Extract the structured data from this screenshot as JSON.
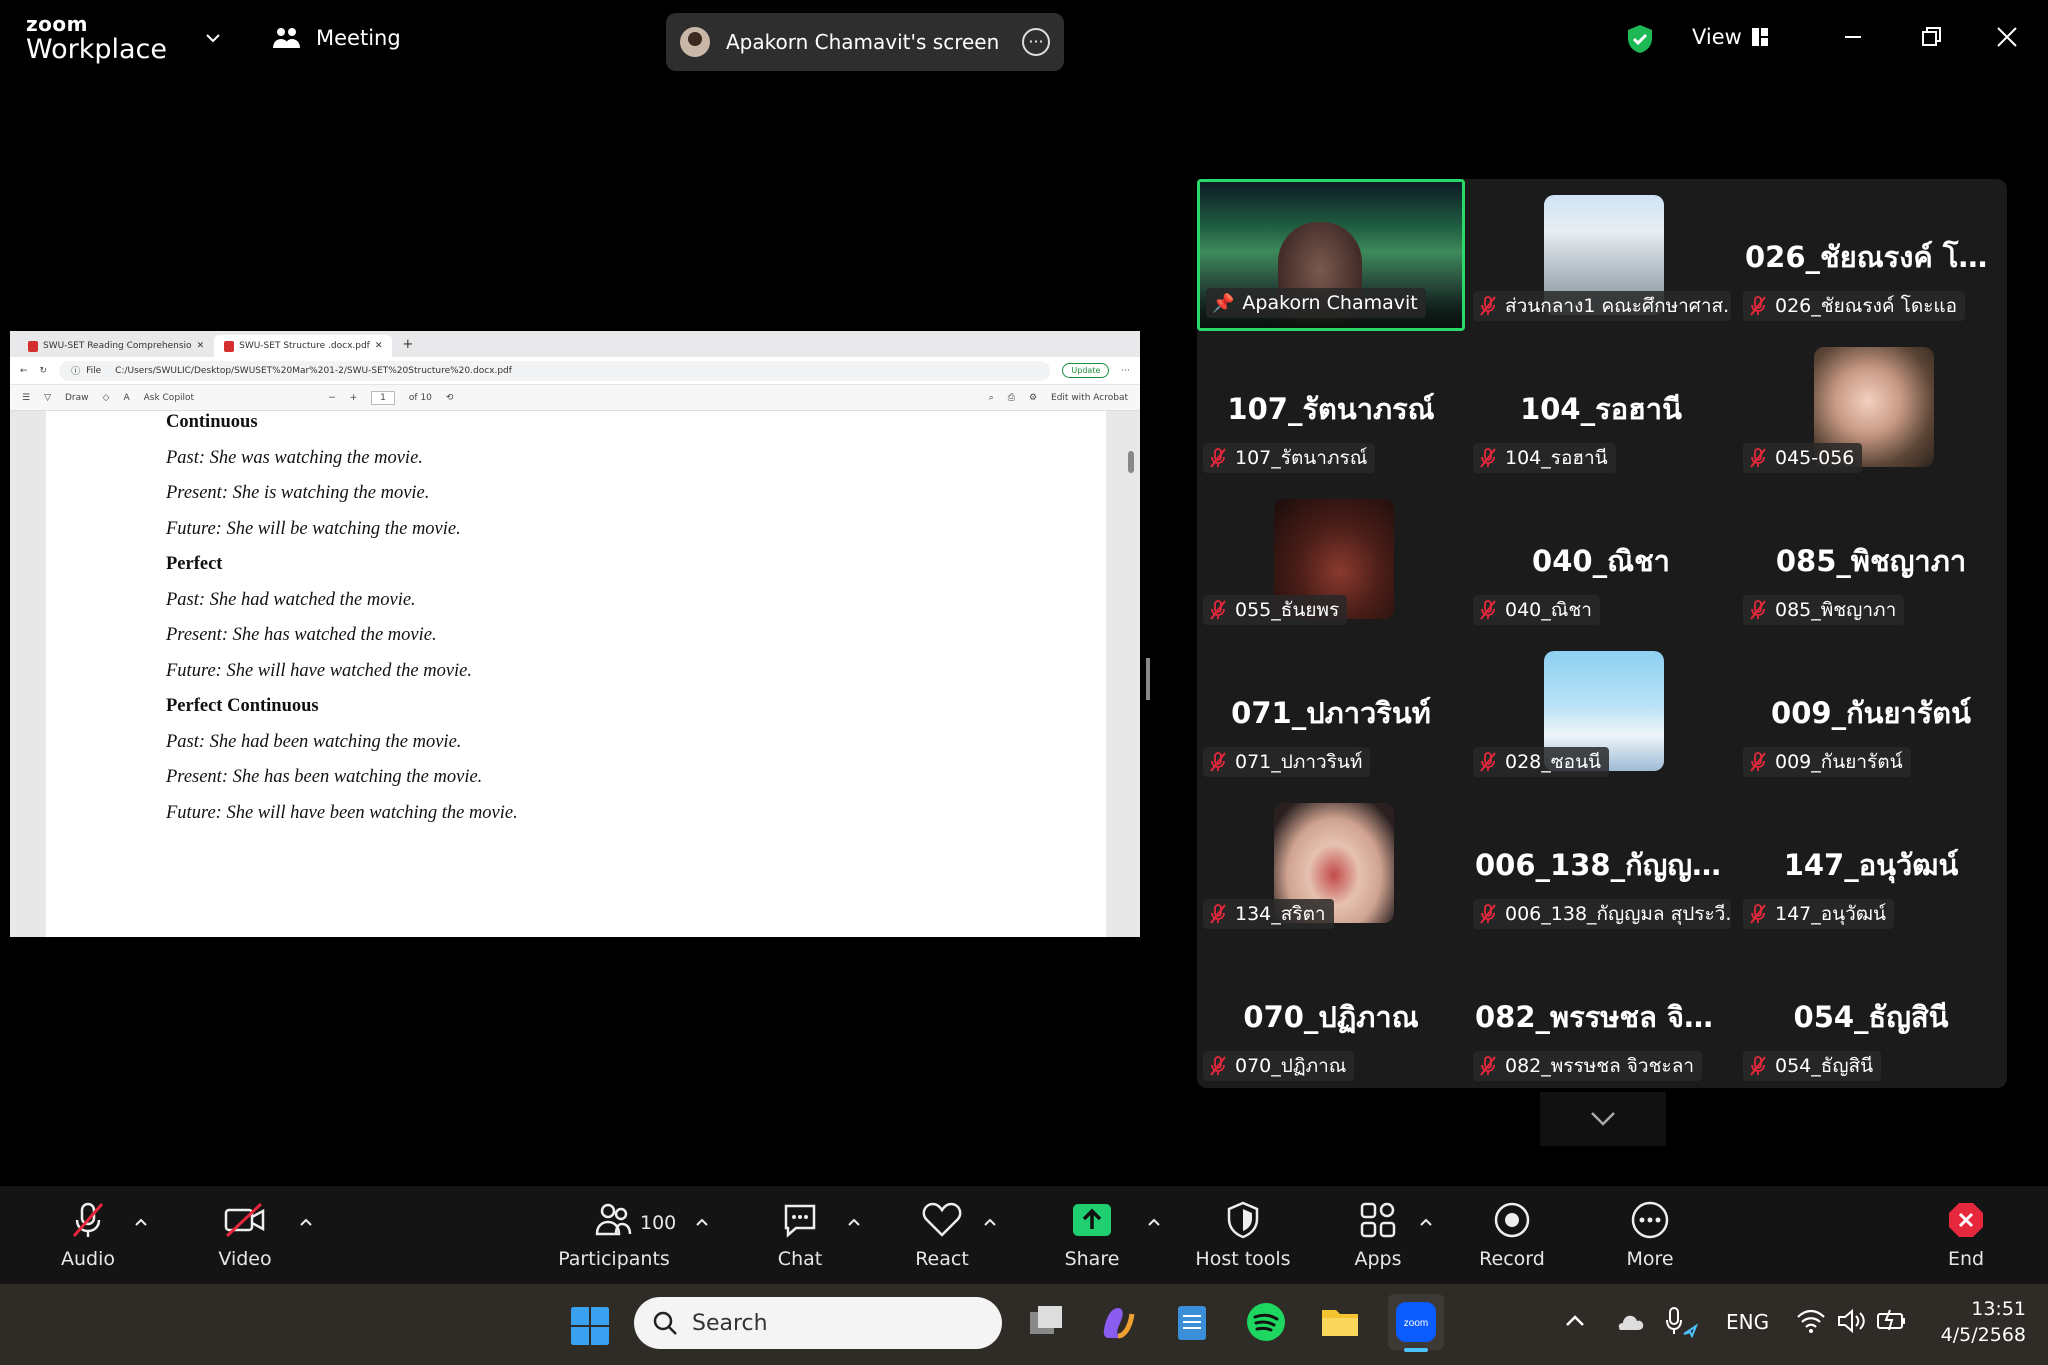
{
  "app": {
    "brand_top": "zoom",
    "brand_bottom": "Workplace",
    "meeting_label": "Meeting"
  },
  "share_pill": {
    "label": "Apakorn Chamavit's screen"
  },
  "header": {
    "view_label": "View"
  },
  "shared_screen": {
    "tabs": [
      "SWU-SET Reading Comprehensio",
      "SWU-SET Structure .docx.pdf"
    ],
    "file_label": "File",
    "url": "C:/Users/SWULIC/Desktop/SWUSET%20Mar%201-2/SWU-SET%20Structure%20.docx.pdf",
    "update_label": "Update",
    "tools": {
      "draw": "Draw",
      "copilot": "Ask Copilot",
      "page": "1",
      "of_pages": "of 10",
      "edit_acrobat": "Edit with Acrobat"
    },
    "lines": [
      {
        "text": "Continuous",
        "style": "h"
      },
      {
        "text": "Past: She was watching the movie.",
        "style": "i"
      },
      {
        "text": "Present: She is watching the movie.",
        "style": "i"
      },
      {
        "text": "Future: She will be watching the movie.",
        "style": "i"
      },
      {
        "text": "Perfect",
        "style": "h"
      },
      {
        "text": "Past: She had watched the movie.",
        "style": "i"
      },
      {
        "text": "Present: She has watched the movie.",
        "style": "i"
      },
      {
        "text": "Future: She will have watched the movie.",
        "style": "i"
      },
      {
        "text": "Perfect Continuous",
        "style": "h"
      },
      {
        "text": "Past: She had been watching the movie.",
        "style": "i"
      },
      {
        "text": "Present: She has been watching the movie.",
        "style": "i"
      },
      {
        "text": "Future: She will have been watching the movie.",
        "style": "i"
      }
    ]
  },
  "gallery": {
    "tiles": [
      {
        "big": "",
        "tag": "Apakorn Chamavit",
        "kind": "host"
      },
      {
        "big": "",
        "tag": "ส่วนกลาง1 คณะศึกษาศาส...",
        "kind": "avatar",
        "avatar": "building"
      },
      {
        "big": "026_ชัยณรงค์ โด...",
        "tag": "026_ชัยณรงค์ โดะแอ",
        "kind": "name"
      },
      {
        "big": "107_รัตนาภรณ์",
        "tag": "107_รัตนาภรณ์",
        "kind": "name"
      },
      {
        "big": "104_รอฮานี",
        "tag": "104_รอฮานี",
        "kind": "name"
      },
      {
        "big": "",
        "tag": "045-056",
        "kind": "avatar",
        "avatar": "girl"
      },
      {
        "big": "",
        "tag": "055_ธันยพร",
        "kind": "avatar",
        "avatar": "dark"
      },
      {
        "big": "040_ณิชา",
        "tag": "040_ณิชา",
        "kind": "name"
      },
      {
        "big": "085_พิชญาภา",
        "tag": "085_พิชญาภา",
        "kind": "name"
      },
      {
        "big": "071_ปภาวรินท์",
        "tag": "071_ปภาวรินท์",
        "kind": "name"
      },
      {
        "big": "",
        "tag": "028_ซอนนี",
        "kind": "avatar",
        "avatar": "anime"
      },
      {
        "big": "009_กันยารัตน์",
        "tag": "009_กันยารัตน์",
        "kind": "name"
      },
      {
        "big": "",
        "tag": "134_สริตา",
        "kind": "avatar",
        "avatar": "selfie"
      },
      {
        "big": "006_138_กัญญม...",
        "tag": "006_138_กัญญมล สุประวี...",
        "kind": "name"
      },
      {
        "big": "147_อนุวัฒน์",
        "tag": "147_อนุวัฒน์",
        "kind": "name"
      },
      {
        "big": "070_ปฏิภาณ",
        "tag": "070_ปฏิภาณ",
        "kind": "name"
      },
      {
        "big": "082_พรรษชล จิว...",
        "tag": "082_พรรษชล จิวชะลา",
        "kind": "name"
      },
      {
        "big": "054_ธัญสินี",
        "tag": "054_ธัญสินี",
        "kind": "name"
      }
    ]
  },
  "toolbar": {
    "audio": "Audio",
    "video": "Video",
    "participants": "Participants",
    "participant_count": "100",
    "chat": "Chat",
    "react": "React",
    "share": "Share",
    "host_tools": "Host tools",
    "apps": "Apps",
    "record": "Record",
    "more": "More",
    "end": "End"
  },
  "colors": {
    "share_green": "#20d070",
    "end_red": "#e5283c",
    "host_border": "#2bd86a",
    "shield_green": "#1db954"
  },
  "taskbar": {
    "search_placeholder": "Search",
    "language": "ENG",
    "time": "13:51",
    "date": "4/5/2568"
  }
}
